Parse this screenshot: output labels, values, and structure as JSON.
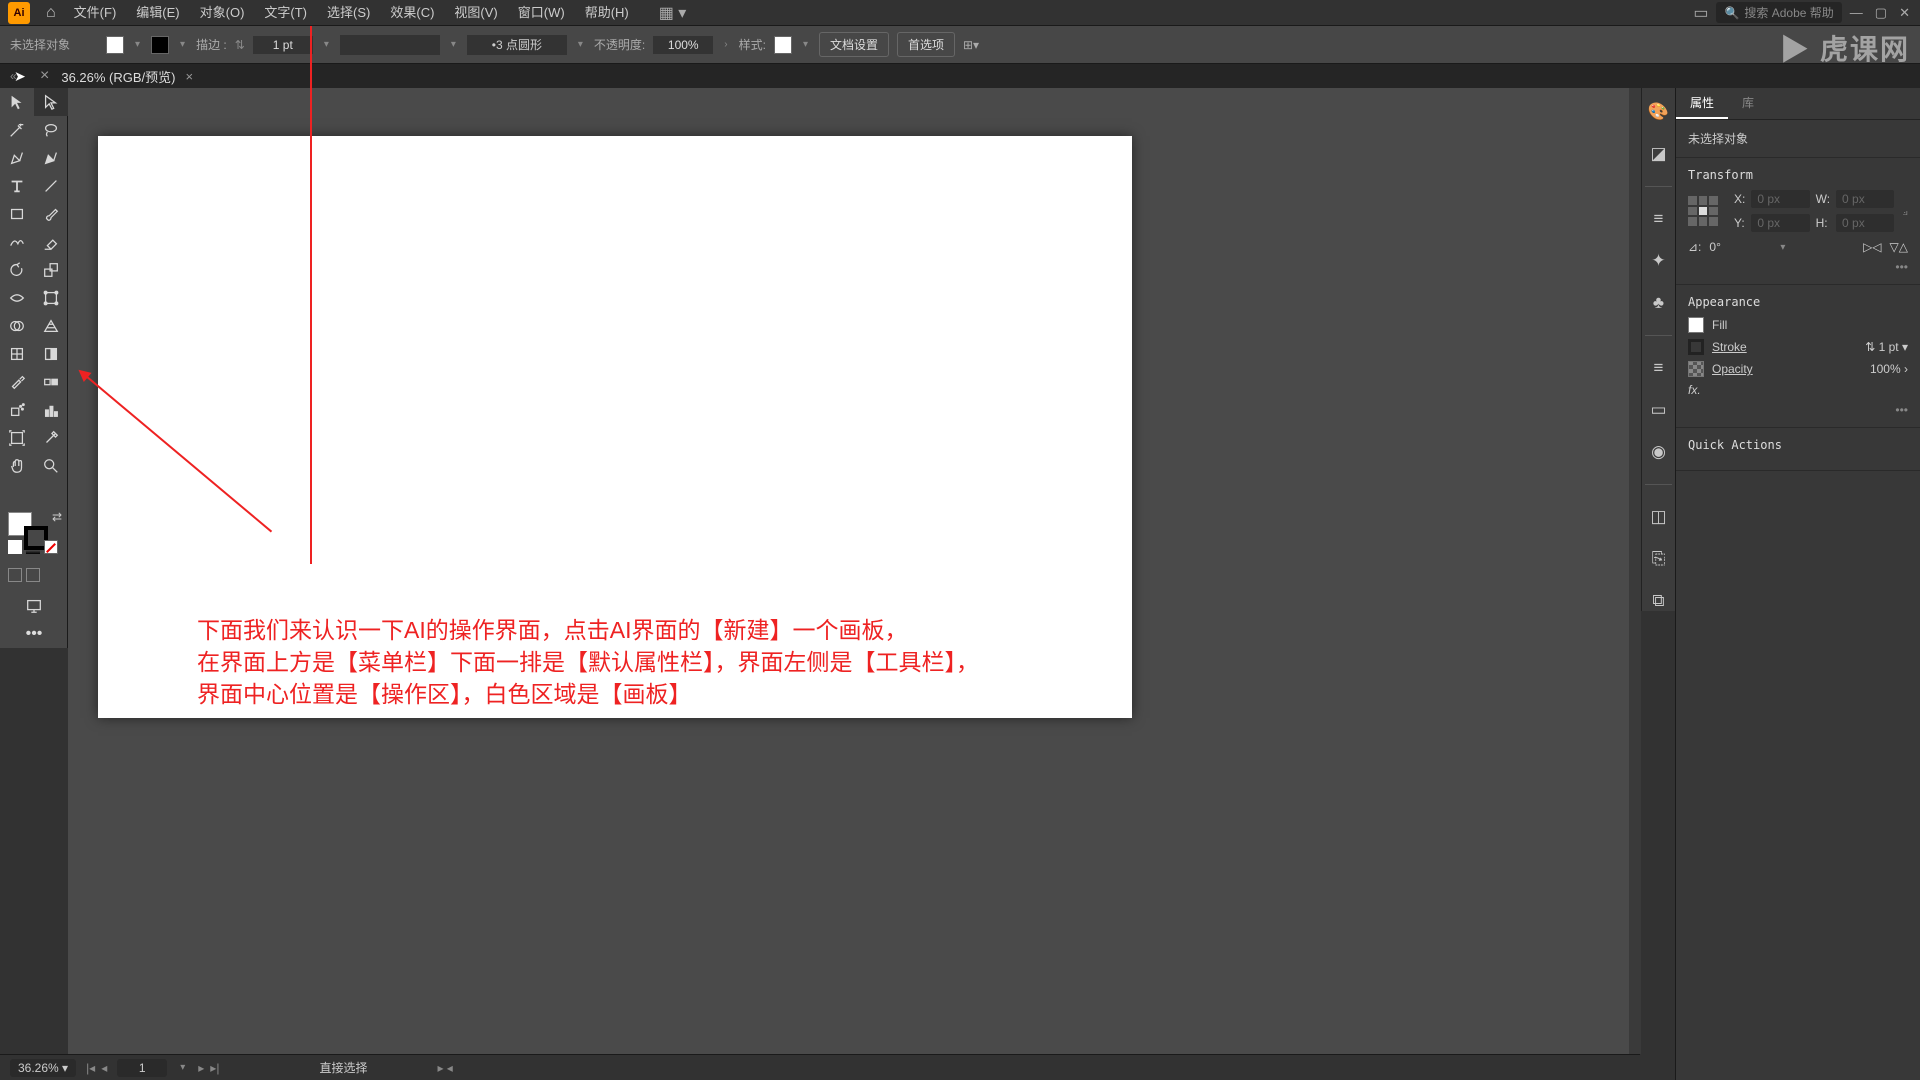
{
  "menubar": {
    "items": [
      "文件(F)",
      "编辑(E)",
      "对象(O)",
      "文字(T)",
      "选择(S)",
      "效果(C)",
      "视图(V)",
      "窗口(W)",
      "帮助(H)"
    ],
    "search_placeholder": "搜索 Adobe 帮助"
  },
  "control_bar": {
    "no_selection": "未选择对象",
    "stroke_label": "描边 :",
    "stroke_value": "1 pt",
    "dash_label": "3 点圆形",
    "opacity_label": "不透明度:",
    "opacity_value": "100%",
    "style_label": "样式:",
    "doc_setup": "文档设置",
    "prefs": "首选项"
  },
  "doc_tab": "36.26% (RGB/预览)",
  "panel": {
    "tabs": [
      "属性",
      "库"
    ],
    "no_selection": "未选择对象",
    "transform": {
      "head": "Transform",
      "x_label": "X:",
      "y_label": "Y:",
      "w_label": "W:",
      "h_label": "H:",
      "x": "0 px",
      "y": "0 px",
      "w": "0 px",
      "h": "0 px",
      "angle_label": "⊿:",
      "angle": "0°"
    },
    "appearance": {
      "head": "Appearance",
      "fill": "Fill",
      "stroke": "Stroke",
      "stroke_v": "1 pt",
      "opacity": "Opacity",
      "opacity_v": "100%",
      "fx": "fx."
    },
    "quick": "Quick Actions"
  },
  "footer": {
    "zoom": "36.26%",
    "page": "1",
    "tool": "直接选择"
  },
  "annotation": {
    "line1": "下面我们来认识一下AI的操作界面，点击AI界面的【新建】一个画板，",
    "line2": "在界面上方是【菜单栏】下面一排是【默认属性栏】，界面左侧是【工具栏】，",
    "line3": "界面中心位置是【操作区】，白色区域是【画板】"
  },
  "watermark": "虎课网"
}
